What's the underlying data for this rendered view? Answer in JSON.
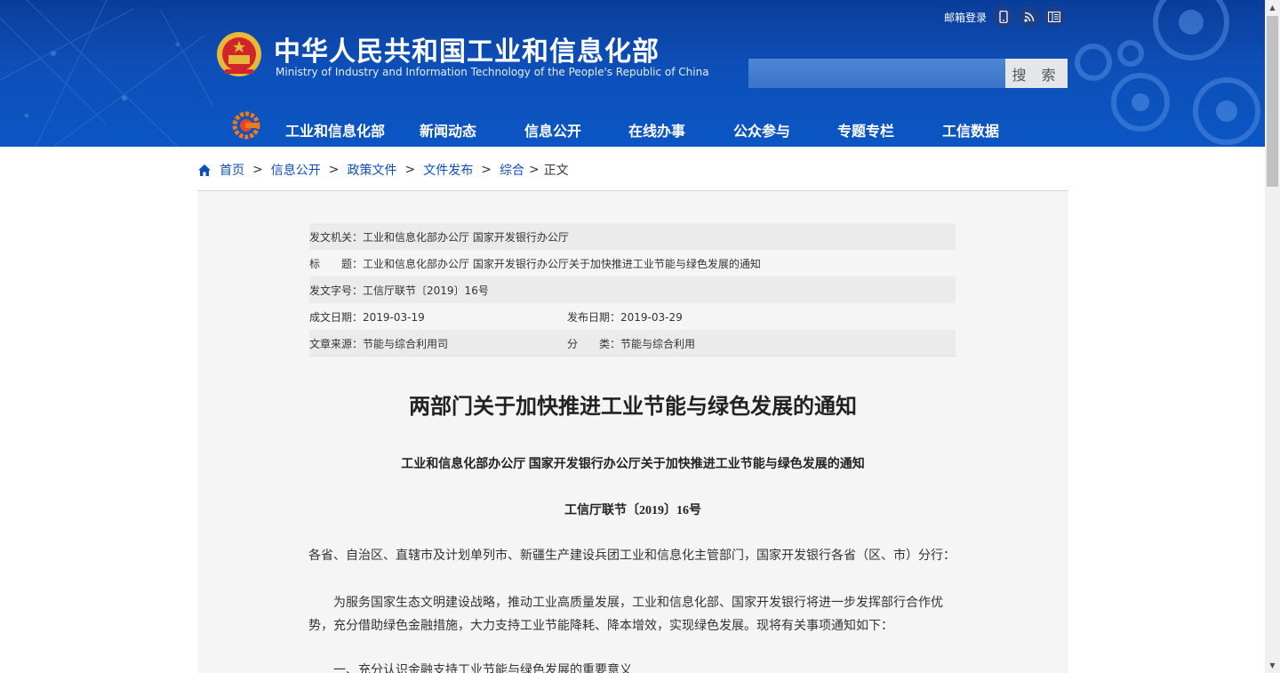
{
  "header": {
    "title_cn": "中华人民共和国工业和信息化部",
    "title_en": "Ministry of Industry and Information Technology of the People's Republic of China",
    "mail_login": "邮箱登录",
    "search": {
      "button_label": "搜 索",
      "value": ""
    },
    "top_icons": [
      "mobile-icon",
      "rss-icon",
      "reader-icon"
    ],
    "nav": [
      "工业和信息化部",
      "新闻动态",
      "信息公开",
      "在线办事",
      "公众参与",
      "专题专栏",
      "工信数据"
    ]
  },
  "breadcrumb": {
    "items": [
      "首页",
      "信息公开",
      "政策文件",
      "文件发布",
      "综合"
    ],
    "current": "正文"
  },
  "meta": {
    "issuer_label": "发文机关：",
    "issuer": "工业和信息化部办公厅 国家开发银行办公厅",
    "title_label": "标　　题：",
    "title": "工业和信息化部办公厅 国家开发银行办公厅关于加快推进工业节能与绿色发展的通知",
    "docno_label": "发文字号：",
    "docno": "工信厅联节〔2019〕16号",
    "written_label": "成文日期：",
    "written": "2019-03-19",
    "published_label": "发布日期：",
    "published": "2019-03-29",
    "source_label": "文章来源：",
    "source": "节能与综合利用司",
    "category_label": "分　　类：",
    "category": "节能与综合利用"
  },
  "article": {
    "title": "两部门关于加快推进工业节能与绿色发展的通知",
    "subtitle": "工业和信息化部办公厅  国家开发银行办公厅关于加快推进工业节能与绿色发展的通知",
    "docno": "工信厅联节〔2019〕16号",
    "addressee": "各省、自治区、直辖市及计划单列市、新疆生产建设兵团工业和信息化主管部门，国家开发银行各省（区、市）分行：",
    "para1": "为服务国家生态文明建设战略，推动工业高质量发展，工业和信息化部、国家开发银行将进一步发挥部行合作优势，充分借助绿色金融措施，大力支持工业节能降耗、降本增效，实现绿色发展。现将有关事项通知如下：",
    "para2": "一、充分认识金融支持工业节能与绿色发展的重要意义"
  },
  "colors": {
    "header_blue": "#0d4fb8",
    "link_blue": "#0d4fb8",
    "panel_bg": "#f5f5f5"
  }
}
